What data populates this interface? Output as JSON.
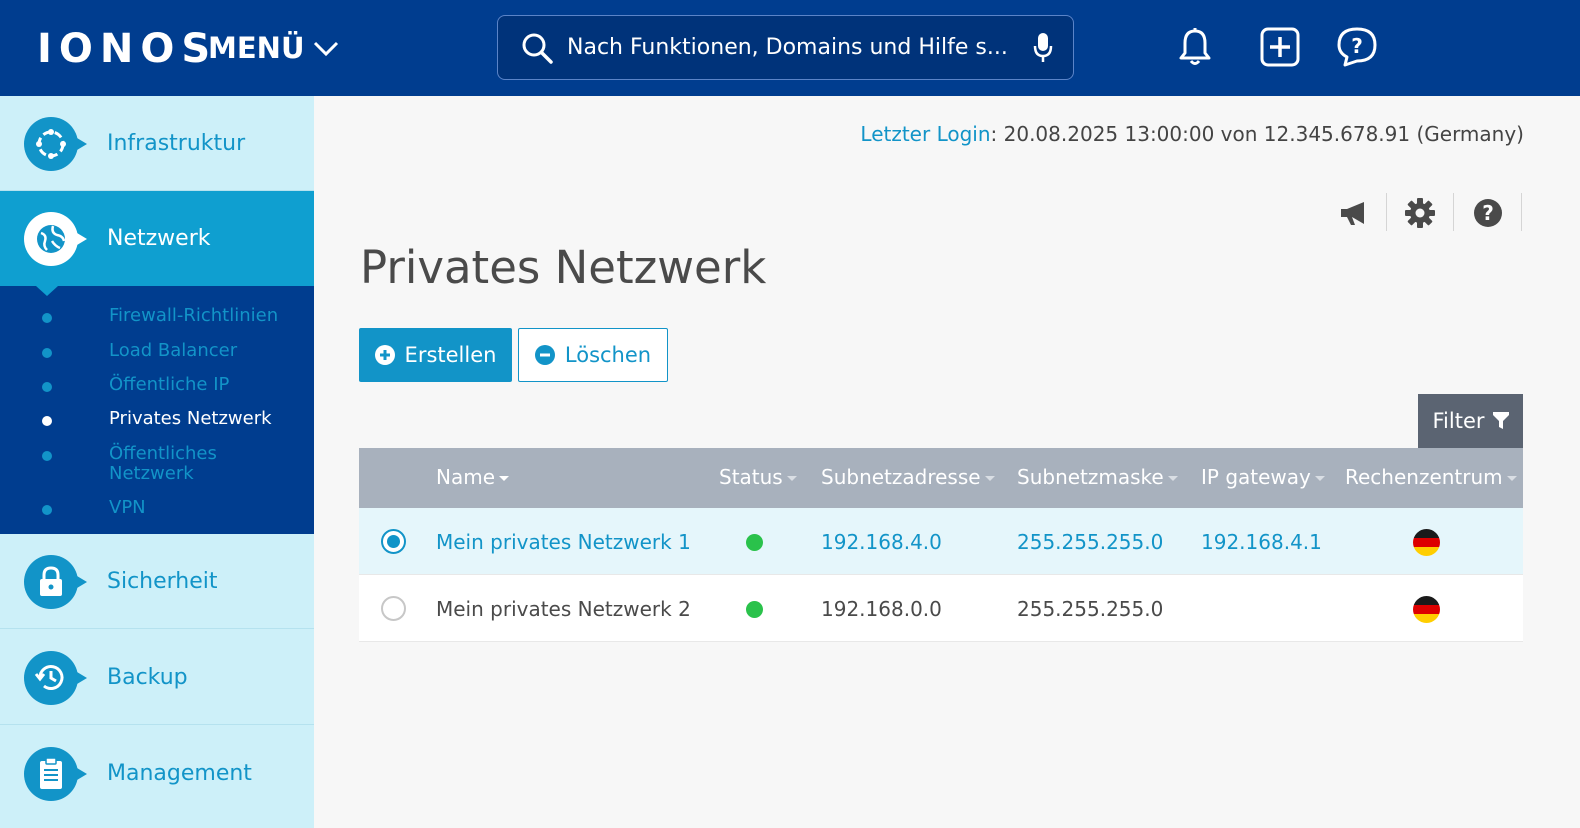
{
  "topbar": {
    "logo": "IONOS",
    "menu_label": "MENÜ",
    "search_placeholder": "Nach Funktionen, Domains und Hilfe s...",
    "icons": [
      "bell-icon",
      "plus-square-icon",
      "help-chat-icon"
    ]
  },
  "sidebar": {
    "items": [
      {
        "label": "Infrastruktur",
        "icon": "infrastructure-icon"
      },
      {
        "label": "Netzwerk",
        "icon": "network-globe-icon"
      },
      {
        "label": "Sicherheit",
        "icon": "lock-icon"
      },
      {
        "label": "Backup",
        "icon": "backup-clock-icon"
      },
      {
        "label": "Management",
        "icon": "clipboard-icon"
      }
    ],
    "submenu": [
      {
        "label": "Firewall-Richtlinien"
      },
      {
        "label": "Load Balancer"
      },
      {
        "label": "Öffentliche IP"
      },
      {
        "label": "Privates Netzwerk"
      },
      {
        "label": "Öffentliches Netzwerk"
      },
      {
        "label": "VPN"
      }
    ]
  },
  "main": {
    "last_login_label": "Letzter Login",
    "last_login_value": ": 20.08.2025 13:00:00 von 12.345.678.91 (Germany)",
    "toolbar_icons": [
      "megaphone-icon",
      "gear-icon",
      "question-icon"
    ],
    "title": "Privates Netzwerk",
    "create_label": "Erstellen",
    "delete_label": "Löschen",
    "filter_label": "Filter",
    "table": {
      "headers": {
        "name": "Name",
        "status": "Status",
        "subnet_address": "Subnetzadresse",
        "subnet_mask": "Subnetzmaske",
        "ip_gateway": "IP gateway",
        "datacenter": "Rechenzentrum"
      },
      "rows": [
        {
          "selected": true,
          "name": "Mein privates Netzwerk 1",
          "status": "green",
          "subnet_address": "192.168.4.0",
          "subnet_mask": "255.255.255.0",
          "ip_gateway": "192.168.4.1",
          "datacenter": "de-flag-icon"
        },
        {
          "selected": false,
          "name": "Mein privates Netzwerk 2",
          "status": "green",
          "subnet_address": "192.168.0.0",
          "subnet_mask": "255.255.255.0",
          "ip_gateway": "",
          "datacenter": "de-flag-icon"
        }
      ]
    }
  },
  "colors": {
    "topbar": "#003d8f",
    "accent": "#1294c8",
    "sidebar_bg": "#cdf0f9",
    "status_green": "#2ac24b",
    "table_header": "#a8b1bd"
  }
}
